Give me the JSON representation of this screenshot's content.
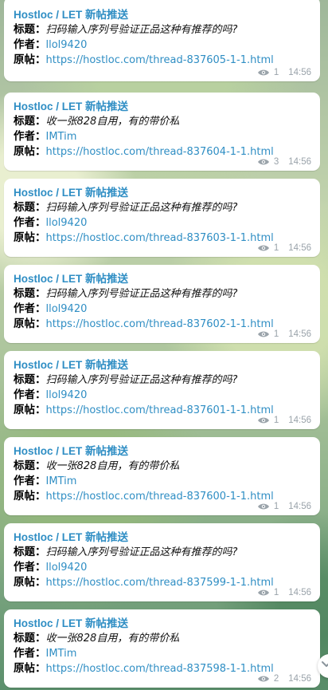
{
  "messages": [
    {
      "sender": "Hostloc / LET 新帖推送",
      "title_label": "标题：",
      "title": "扫码输入序列号验证正品这种有推荐的吗?",
      "author_label": "作者：",
      "author": "llol9420",
      "link_label": "原帖：",
      "link": "https://hostloc.com/thread-837605-1-1.html",
      "views": "1",
      "time": "14:56"
    },
    {
      "sender": "Hostloc / LET 新帖推送",
      "title_label": "标题：",
      "title": "收一张828自用，有的带价私",
      "author_label": "作者：",
      "author": "IMTim",
      "link_label": "原帖：",
      "link": "https://hostloc.com/thread-837604-1-1.html",
      "views": "3",
      "time": "14:56"
    },
    {
      "sender": "Hostloc / LET 新帖推送",
      "title_label": "标题：",
      "title": "扫码输入序列号验证正品这种有推荐的吗?",
      "author_label": "作者：",
      "author": "llol9420",
      "link_label": "原帖：",
      "link": "https://hostloc.com/thread-837603-1-1.html",
      "views": "1",
      "time": "14:56"
    },
    {
      "sender": "Hostloc / LET 新帖推送",
      "title_label": "标题：",
      "title": "扫码输入序列号验证正品这种有推荐的吗?",
      "author_label": "作者：",
      "author": "llol9420",
      "link_label": "原帖：",
      "link": "https://hostloc.com/thread-837602-1-1.html",
      "views": "1",
      "time": "14:56"
    },
    {
      "sender": "Hostloc / LET 新帖推送",
      "title_label": "标题：",
      "title": "扫码输入序列号验证正品这种有推荐的吗?",
      "author_label": "作者：",
      "author": "llol9420",
      "link_label": "原帖：",
      "link": "https://hostloc.com/thread-837601-1-1.html",
      "views": "1",
      "time": "14:56"
    },
    {
      "sender": "Hostloc / LET 新帖推送",
      "title_label": "标题：",
      "title": "收一张828自用，有的带价私",
      "author_label": "作者：",
      "author": "IMTim",
      "link_label": "原帖：",
      "link": "https://hostloc.com/thread-837600-1-1.html",
      "views": "1",
      "time": "14:56"
    },
    {
      "sender": "Hostloc / LET 新帖推送",
      "title_label": "标题：",
      "title": "扫码输入序列号验证正品这种有推荐的吗?",
      "author_label": "作者：",
      "author": "llol9420",
      "link_label": "原帖：",
      "link": "https://hostloc.com/thread-837599-1-1.html",
      "views": "1",
      "time": "14:56"
    },
    {
      "sender": "Hostloc / LET 新帖推送",
      "title_label": "标题：",
      "title": "收一张828自用，有的带价私",
      "author_label": "作者：",
      "author": "IMTim",
      "link_label": "原帖：",
      "link": "https://hostloc.com/thread-837598-1-1.html",
      "views": "2",
      "time": "14:56"
    }
  ],
  "icons": {
    "views": "eye-icon",
    "scroll_button": "chevron-down-icon"
  },
  "colors": {
    "accent": "#2f8ec4",
    "meta": "#9aa3aa"
  }
}
